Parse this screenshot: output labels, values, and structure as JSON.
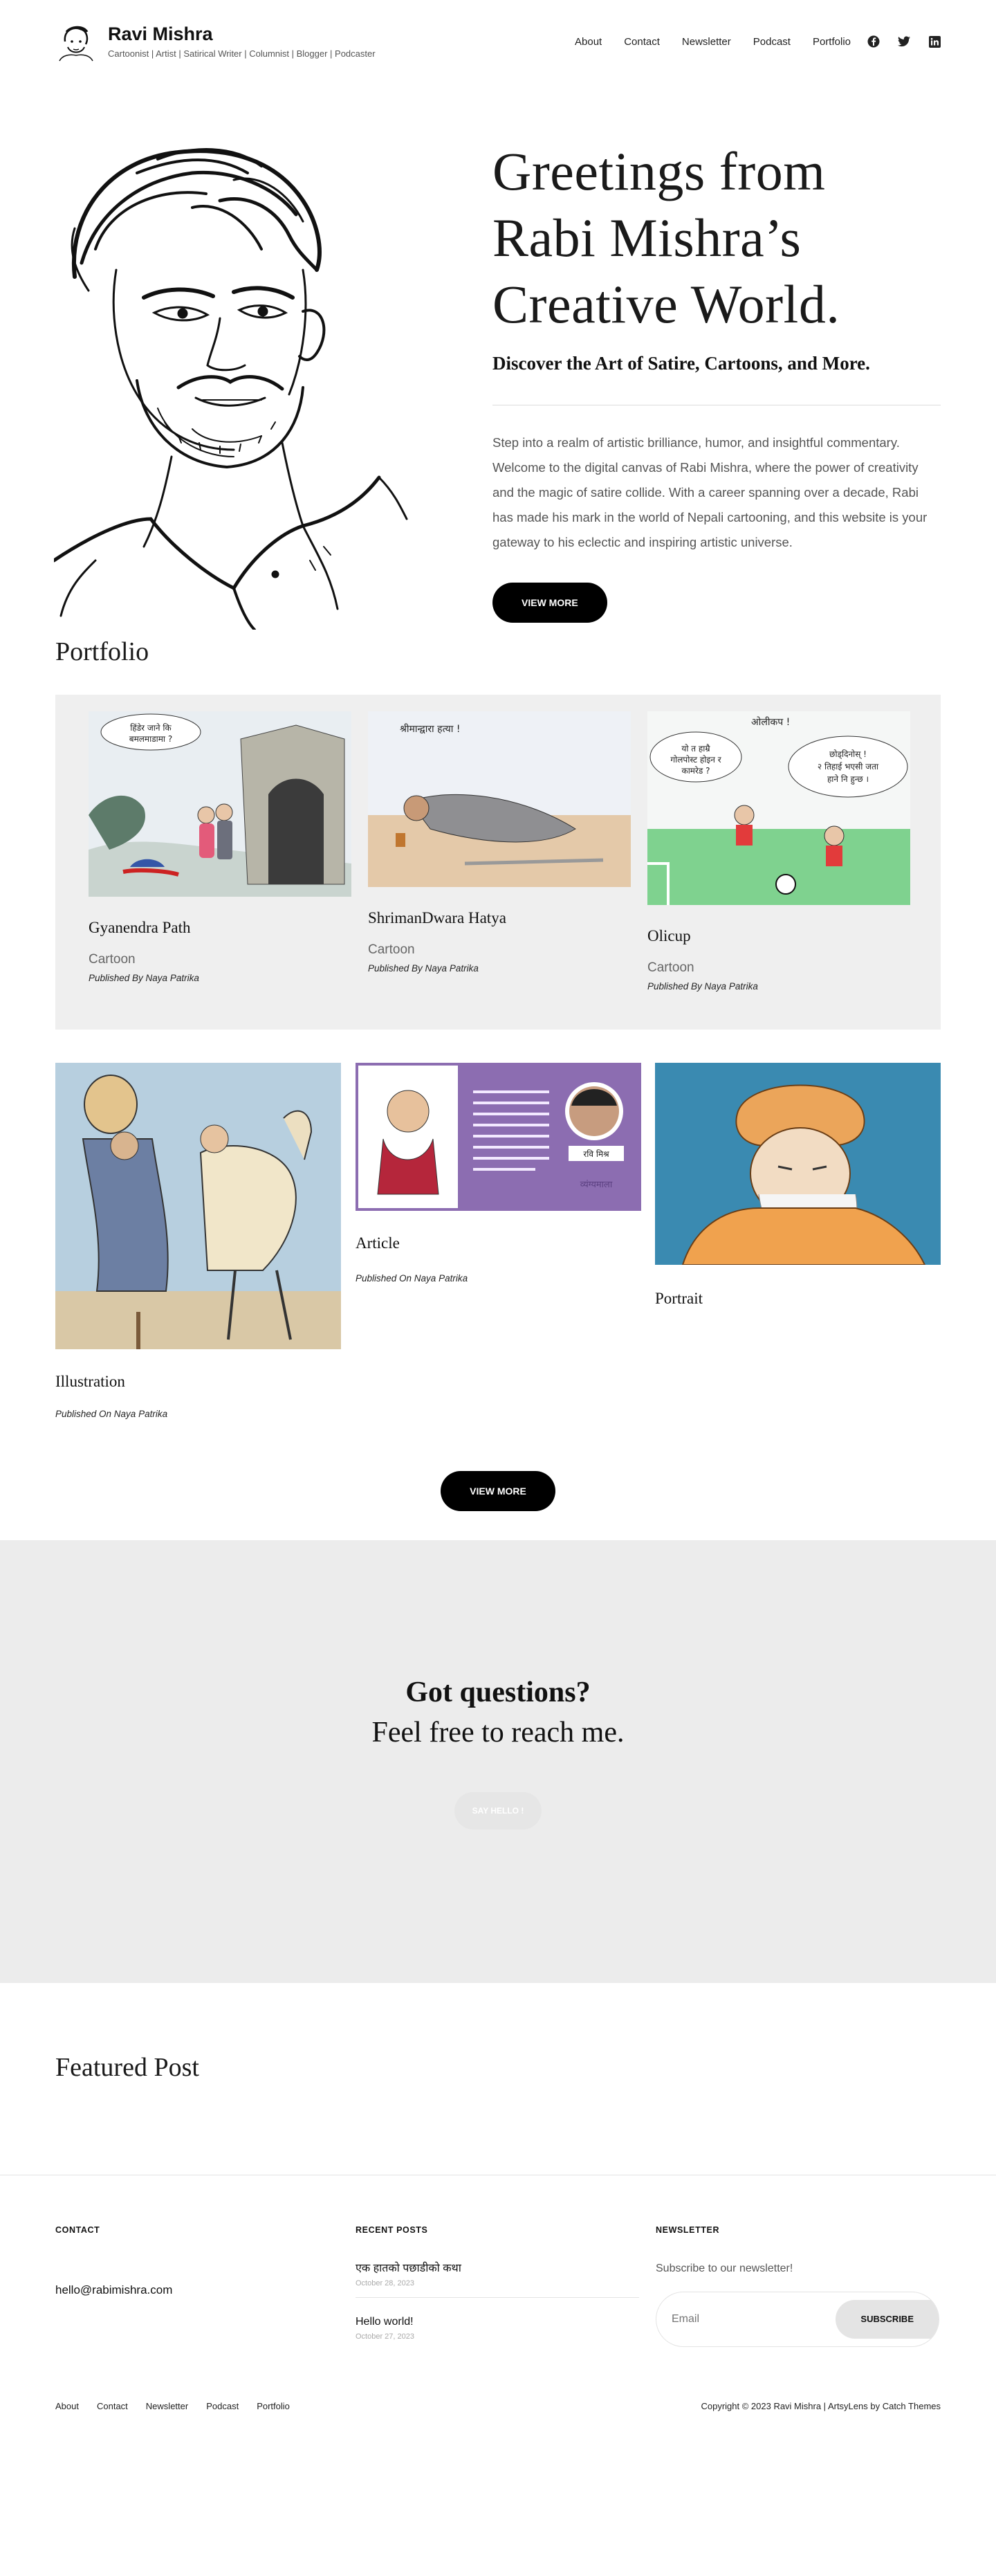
{
  "header": {
    "site_title": "Ravi Mishra",
    "tagline": "Cartoonist | Artist | Satirical Writer | Columnist | Blogger | Podcaster",
    "nav": [
      "About",
      "Contact",
      "Newsletter",
      "Podcast",
      "Portfolio"
    ],
    "social_icons": [
      "facebook-icon",
      "twitter-icon",
      "linkedin-icon"
    ]
  },
  "hero": {
    "title": "Greetings from Rabi Mishra’s Creative World.",
    "subtitle": "Discover the Art of Satire, Cartoons, and More.",
    "body": "Step into a realm of artistic brilliance, humor, and insightful commentary. Welcome to the digital canvas of Rabi Mishra, where the power of creativity and the magic of satire collide. With a career spanning over a decade, Rabi has made his mark in the world of Nepali cartooning, and this website is your gateway to his eclectic and inspiring artistic universe.",
    "button": "VIEW MORE"
  },
  "portfolio": {
    "title": "Portfolio",
    "featured_items": [
      {
        "title": "Gyanendra Path",
        "category": "Cartoon",
        "published": "Published By Naya Patrika",
        "bubble": "हिंडेर जाने कि बमलमाडामा ?"
      },
      {
        "title": "ShrimanDwara Hatya",
        "category": "Cartoon",
        "published": "Published By Naya Patrika",
        "caption": "श्रीमान्द्वारा हत्या !"
      },
      {
        "title": "Olicup",
        "category": "Cartoon",
        "published": "Published By Naya Patrika",
        "caption": "ओलीकप !",
        "bubble_left": "यो त हाम्रै गोलपोस्ट होइन र कामरेड ?",
        "bubble_right": "छोड्दिनोस् ! २ तिहाई भएसी जता हाने नि हुन्छ ।"
      }
    ],
    "items": [
      {
        "title": "Illustration",
        "published": "Published On Naya Patrika"
      },
      {
        "title": "Article",
        "published": "Published On Naya Patrika",
        "name_tag": "रवि मिश्र",
        "footer_tag": "व्यंग्यमाला"
      },
      {
        "title": "Portrait",
        "published": ""
      }
    ],
    "button": "VIEW MORE"
  },
  "questions": {
    "title": "Got questions?",
    "subtitle": "Feel free to reach me.",
    "button": "SAY HELLO !"
  },
  "featured": {
    "title": "Featured Post"
  },
  "footer": {
    "contact": {
      "heading": "CONTACT",
      "email": "hello@rabimishra.com"
    },
    "recent": {
      "heading": "RECENT POSTS",
      "posts": [
        {
          "title": "एक हातको पछाडीको कथा",
          "date": "October 28, 2023"
        },
        {
          "title": "Hello world!",
          "date": "October 27, 2023"
        }
      ]
    },
    "newsletter": {
      "heading": "NEWSLETTER",
      "text": "Subscribe to our newsletter!",
      "placeholder": "Email",
      "button": "SUBSCRIBE"
    },
    "nav": [
      "About",
      "Contact",
      "Newsletter",
      "Podcast",
      "Portfolio"
    ],
    "copyright": "Copyright © 2023 Ravi Mishra | ArtsyLens by Catch Themes"
  }
}
